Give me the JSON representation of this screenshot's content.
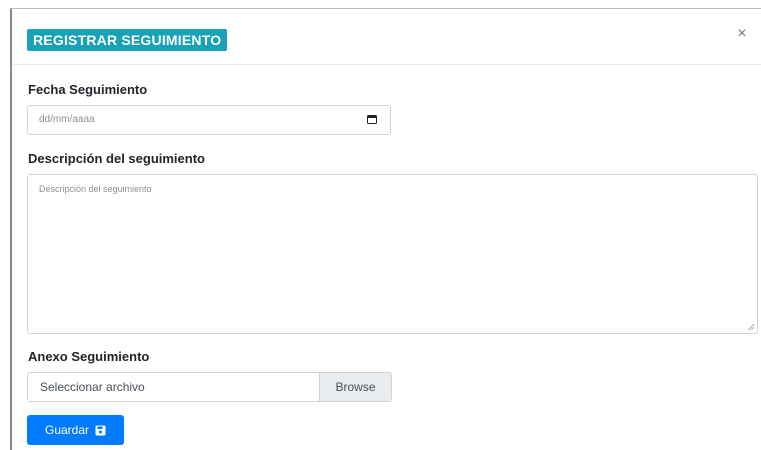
{
  "modal": {
    "title": "REGISTRAR SEGUIMIENTO",
    "close_label": "×"
  },
  "form": {
    "date_field": {
      "label": "Fecha Seguimiento",
      "placeholder": "dd/mm/aaaa"
    },
    "description_field": {
      "label": "Descripción del seguimiento",
      "placeholder": "Descripción del seguimiento"
    },
    "attachment_field": {
      "label": "Anexo Seguimiento",
      "file_label": "Seleccionar archivo",
      "browse_label": "Browse"
    },
    "save_button": {
      "label": "Guardar",
      "icon": "floppy-disk-icon"
    }
  },
  "colors": {
    "title_bg": "#17a2b8",
    "primary": "#007bff",
    "border": "#ced4da",
    "browse_bg": "#e9ecef"
  }
}
